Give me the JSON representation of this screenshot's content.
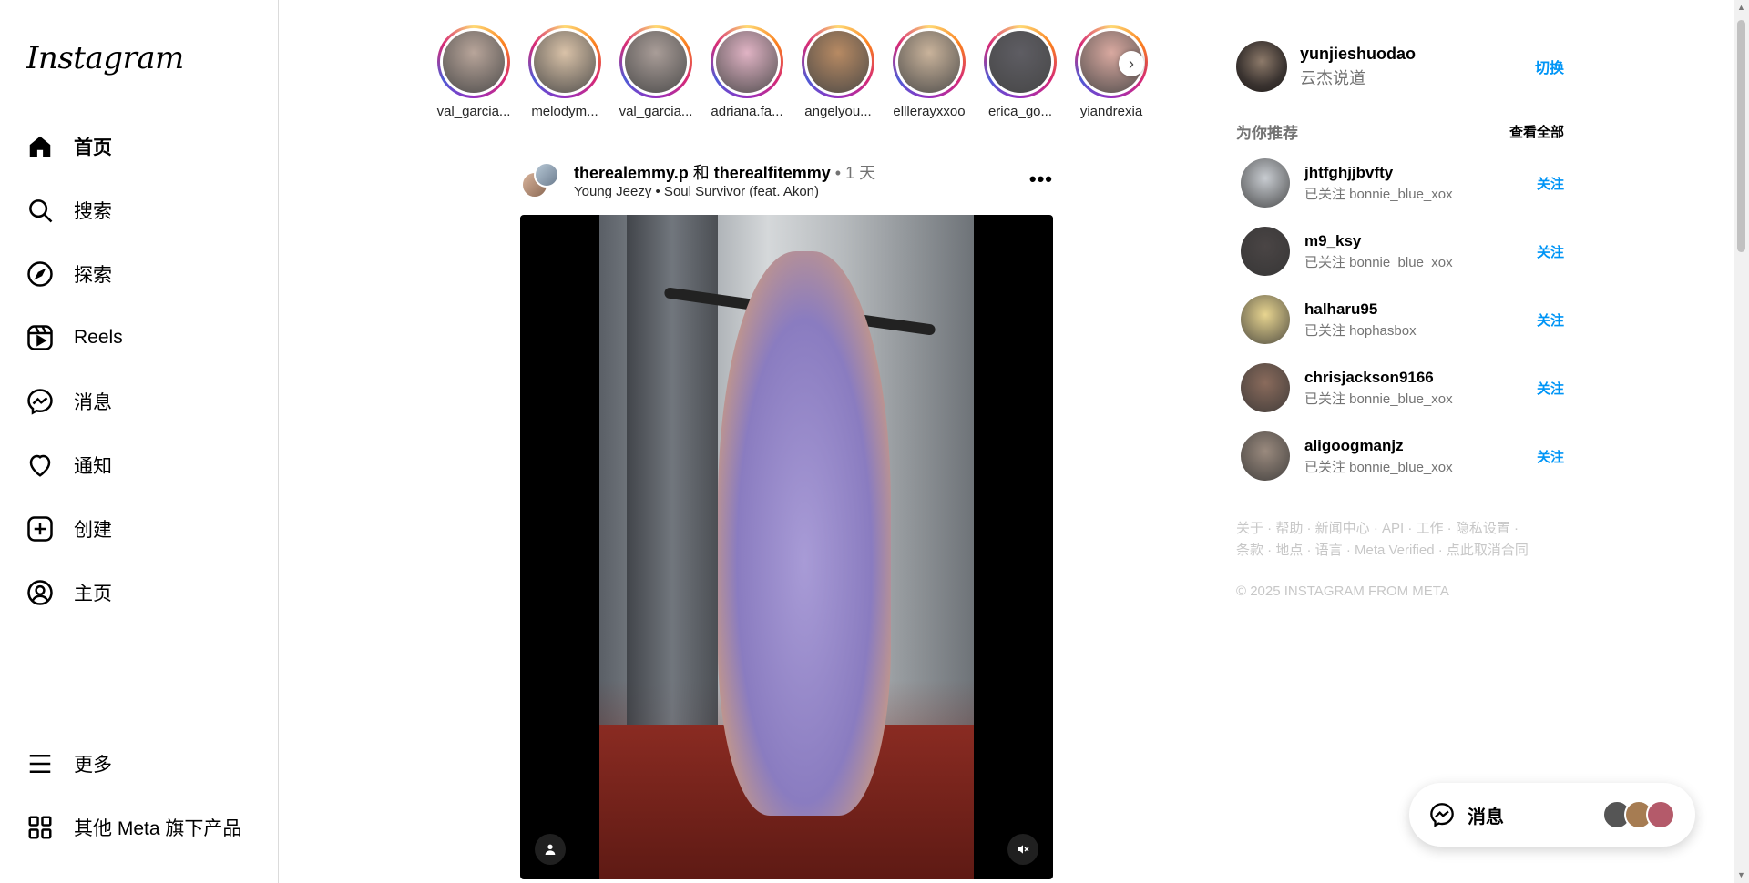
{
  "brand": {
    "logo_text": "Instagram"
  },
  "nav": {
    "items": [
      {
        "label": "首页",
        "icon": "home-icon"
      },
      {
        "label": "搜索",
        "icon": "search-icon"
      },
      {
        "label": "探索",
        "icon": "compass-icon"
      },
      {
        "label": "Reels",
        "icon": "reels-icon"
      },
      {
        "label": "消息",
        "icon": "messenger-icon"
      },
      {
        "label": "通知",
        "icon": "heart-icon"
      },
      {
        "label": "创建",
        "icon": "plus-square-icon"
      },
      {
        "label": "主页",
        "icon": "profile-icon"
      }
    ],
    "bottom": [
      {
        "label": "更多",
        "icon": "menu-icon"
      },
      {
        "label": "其他 Meta 旗下产品",
        "icon": "grid-icon"
      }
    ]
  },
  "stories": [
    {
      "name": "val_garcia...",
      "color": "#b8a59a"
    },
    {
      "name": "melodym...",
      "color": "#d9c2a8"
    },
    {
      "name": "val_garcia...",
      "color": "#a99d98"
    },
    {
      "name": "adriana.fa...",
      "color": "#e0b3c4"
    },
    {
      "name": "angelyou...",
      "color": "#b78a63"
    },
    {
      "name": "elllerayxxoo",
      "color": "#c9b39b"
    },
    {
      "name": "erica_go...",
      "color": "#5e5d63"
    },
    {
      "name": "yiandrexia",
      "color": "#d9a9a0"
    }
  ],
  "post": {
    "author1": "therealemmy.p",
    "and": " 和 ",
    "author2": "therealfitemmy",
    "time": " • 1 天",
    "music": "Young Jeezy • Soul Survivor (feat. Akon)",
    "more": "•••"
  },
  "account": {
    "username": "yunjieshuodao",
    "fullname": "云杰说道",
    "switch_label": "切换"
  },
  "suggestions": {
    "title": "为你推荐",
    "see_all": "查看全部",
    "follow_label": "关注",
    "items": [
      {
        "username": "jhtfghjjbvfty",
        "sub": "已关注 bonnie_blue_xox",
        "color": "#c8ccd1"
      },
      {
        "username": "m9_ksy",
        "sub": "已关注 bonnie_blue_xox",
        "color": "#4a4545"
      },
      {
        "username": "halharu95",
        "sub": "已关注 hophasbox",
        "color": "#e8d590"
      },
      {
        "username": "chrisjackson9166",
        "sub": "已关注 bonnie_blue_xox",
        "color": "#8a6b5c"
      },
      {
        "username": "aligoogmanjz",
        "sub": "已关注 bonnie_blue_xox",
        "color": "#9a8a7e"
      }
    ]
  },
  "footer": {
    "links_line1": "关于 · 帮助 · 新闻中心 · API · 工作 · 隐私设置 ·",
    "links_line2": "条款 · 地点 · 语言 · Meta Verified · 点此取消合同",
    "copyright": "© 2025 INSTAGRAM FROM META"
  },
  "messages_float": {
    "label": "消息"
  },
  "colors": {
    "accent": "#0095f6",
    "muted": "#737373",
    "border": "#dbdbdb"
  }
}
